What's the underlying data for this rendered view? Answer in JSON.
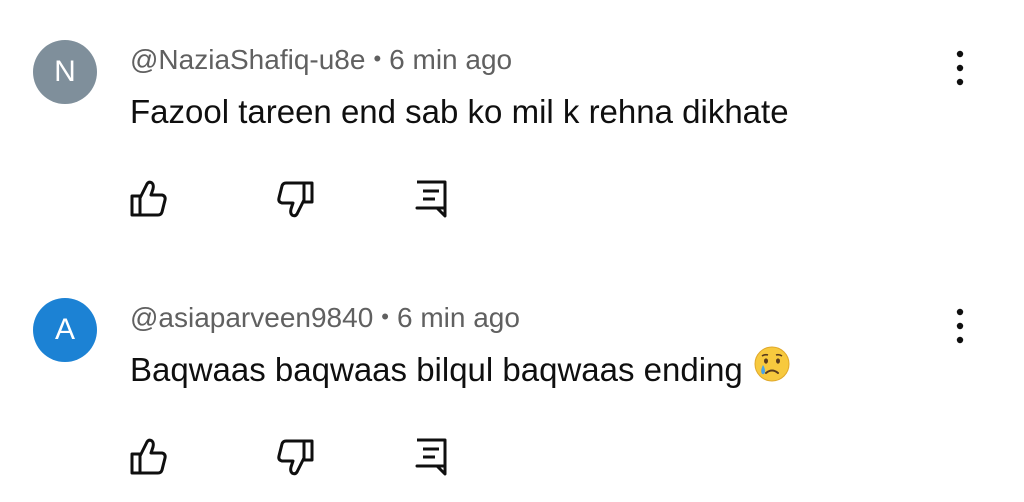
{
  "comments": [
    {
      "avatar_letter": "N",
      "avatar_color": "#7f8f9b",
      "username": "@NaziaShafiq-u8e",
      "separator": "•",
      "time": "6 min ago",
      "text": "Fazool tareen end sab ko mil k rehna dikhate",
      "icons": {
        "like": "thumbs-up-icon",
        "dislike": "thumbs-down-icon",
        "reply": "reply-icon",
        "menu": "more-vert-icon"
      }
    },
    {
      "avatar_letter": "A",
      "avatar_color": "#1c82d4",
      "username": "@asiaparveen9840",
      "separator": "•",
      "time": "6 min ago",
      "text": "Baqwaas baqwaas bilqul baqwaas ending",
      "emoji": "crying-face-emoji",
      "icons": {
        "like": "thumbs-up-icon",
        "dislike": "thumbs-down-icon",
        "reply": "reply-icon",
        "menu": "more-vert-icon"
      }
    }
  ]
}
